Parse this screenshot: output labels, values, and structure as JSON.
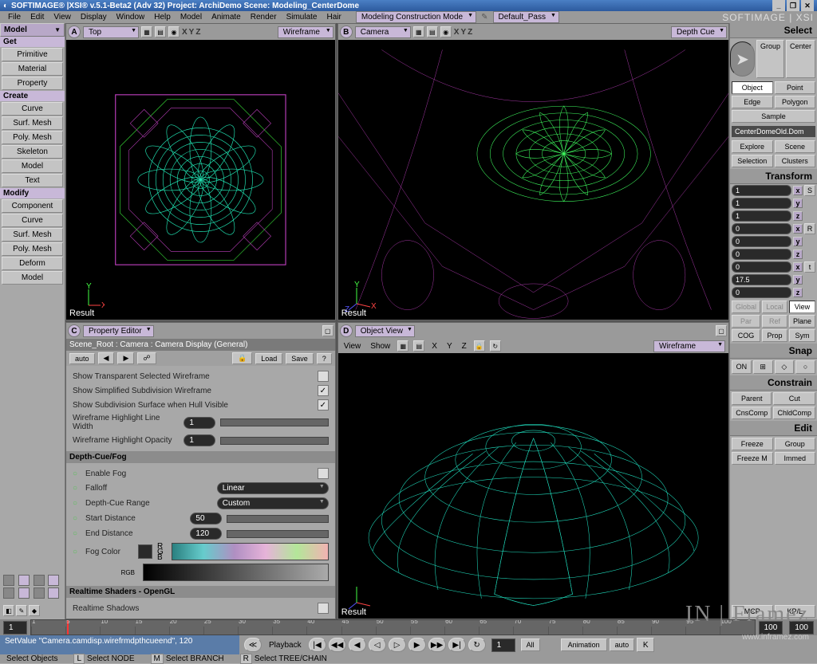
{
  "title": "SOFTIMAGE® |XSI® v.5.1-Beta2 (Adv 32) Project: ArchiDemo    Scene: Modeling_CenterDome",
  "menubar": {
    "items": [
      "File",
      "Edit",
      "View",
      "Display",
      "Window",
      "Help",
      "Model",
      "Animate",
      "Render",
      "Simulate",
      "Hair"
    ],
    "mode": "Modeling Construction Mode",
    "pass": "Default_Pass",
    "brand": "SOFTIMAGE | XSI"
  },
  "leftpanel": {
    "main": "Model",
    "sections": [
      {
        "header": "Get",
        "items": [
          "Primitive",
          "Material",
          "Property"
        ]
      },
      {
        "header": "Create",
        "items": [
          "Curve",
          "Surf. Mesh",
          "Poly. Mesh",
          "Skeleton",
          "Model",
          "Text"
        ]
      },
      {
        "header": "Modify",
        "items": [
          "Component",
          "Curve",
          "Surf. Mesh",
          "Poly. Mesh",
          "Deform",
          "Model"
        ]
      }
    ]
  },
  "viewports": {
    "a": {
      "letter": "A",
      "view": "Top",
      "mode": "Wireframe",
      "result": "Result"
    },
    "b": {
      "letter": "B",
      "view": "Camera",
      "mode": "Depth Cue",
      "result": "Result"
    },
    "c": {
      "letter": "C",
      "title": "Property Editor"
    },
    "d": {
      "letter": "D",
      "title": "Object View",
      "mode": "Wireframe",
      "result": "Result"
    }
  },
  "xyz": [
    "X",
    "Y",
    "Z"
  ],
  "propEditor": {
    "path": "Scene_Root : Camera : Camera Display (General)",
    "toolbar": {
      "auto": "auto",
      "load": "Load",
      "save": "Save"
    },
    "rows": [
      {
        "label": "Show Transparent Selected Wireframe",
        "checked": false
      },
      {
        "label": "Show Simplified Subdivision Wireframe",
        "checked": true
      },
      {
        "label": "Show Subdivision Surface when Hull Visible",
        "checked": true
      },
      {
        "label": "Wireframe Highlight Line Width",
        "value": "1"
      },
      {
        "label": "Wireframe Highlight Opacity",
        "value": "1"
      }
    ],
    "depth": {
      "header": "Depth-Cue/Fog",
      "enable": {
        "label": "Enable Fog",
        "checked": false
      },
      "falloff": {
        "label": "Falloff",
        "value": "Linear"
      },
      "range": {
        "label": "Depth-Cue Range",
        "value": "Custom"
      },
      "start": {
        "label": "Start Distance",
        "value": "50"
      },
      "end": {
        "label": "End Distance",
        "value": "120"
      },
      "fog": {
        "label": "Fog Color",
        "r": "R",
        "g": "G",
        "b": "B",
        "rgb": "RGB"
      }
    },
    "realtime": {
      "header": "Realtime Shaders - OpenGL",
      "shadows": "Realtime Shadows"
    }
  },
  "objView": {
    "menus": [
      "View",
      "Show"
    ]
  },
  "rightpanel": {
    "select": {
      "header": "Select",
      "buttons": [
        "Group",
        "Center",
        "Object",
        "Point",
        "Edge",
        "Polygon",
        "Sample"
      ],
      "objname": "CenterDomeOld.Dom",
      "explore": [
        "Explore",
        "Scene",
        "Selection",
        "Clusters"
      ]
    },
    "transform": {
      "header": "Transform",
      "s": [
        "1",
        "1",
        "1"
      ],
      "r": [
        "0",
        "0",
        "0"
      ],
      "t": [
        "0",
        "17.5",
        "0"
      ],
      "modes": [
        "Global",
        "Local",
        "View",
        "Par",
        "Ref",
        "Plane",
        "COG",
        "Prop",
        "Sym"
      ]
    },
    "snap": {
      "header": "Snap",
      "on": "ON"
    },
    "constrain": {
      "header": "Constrain",
      "buttons": [
        "Parent",
        "Cut",
        "CnsComp",
        "ChldComp"
      ]
    },
    "edit": {
      "header": "Edit",
      "buttons": [
        "Freeze",
        "Group",
        "Freeze M",
        "Immed"
      ]
    }
  },
  "timeline": {
    "start": "1",
    "end": "100",
    "end2": "100",
    "ticks": [
      1,
      5,
      10,
      15,
      20,
      25,
      30,
      35,
      40,
      45,
      50,
      55,
      60,
      65,
      70,
      75,
      80,
      85,
      90,
      95,
      100
    ]
  },
  "playback": {
    "label": "Playback",
    "frame": "1",
    "all": "All",
    "anim": "Animation",
    "auto": "auto",
    "mcp": "MCP",
    "kpl": "KP/L"
  },
  "status": "SetValue \"Camera.camdisp.wirefrmdpthcueend\", 120",
  "bottom": {
    "sel": "Select Objects",
    "node": "Select NODE",
    "branch": "Select BRANCH",
    "tree": "Select TREE/CHAIN",
    "keys": {
      "l": "L",
      "m": "M",
      "r": "R"
    }
  },
  "watermark": {
    "text": "IN | Framez",
    "url": "www.inframez.com"
  }
}
